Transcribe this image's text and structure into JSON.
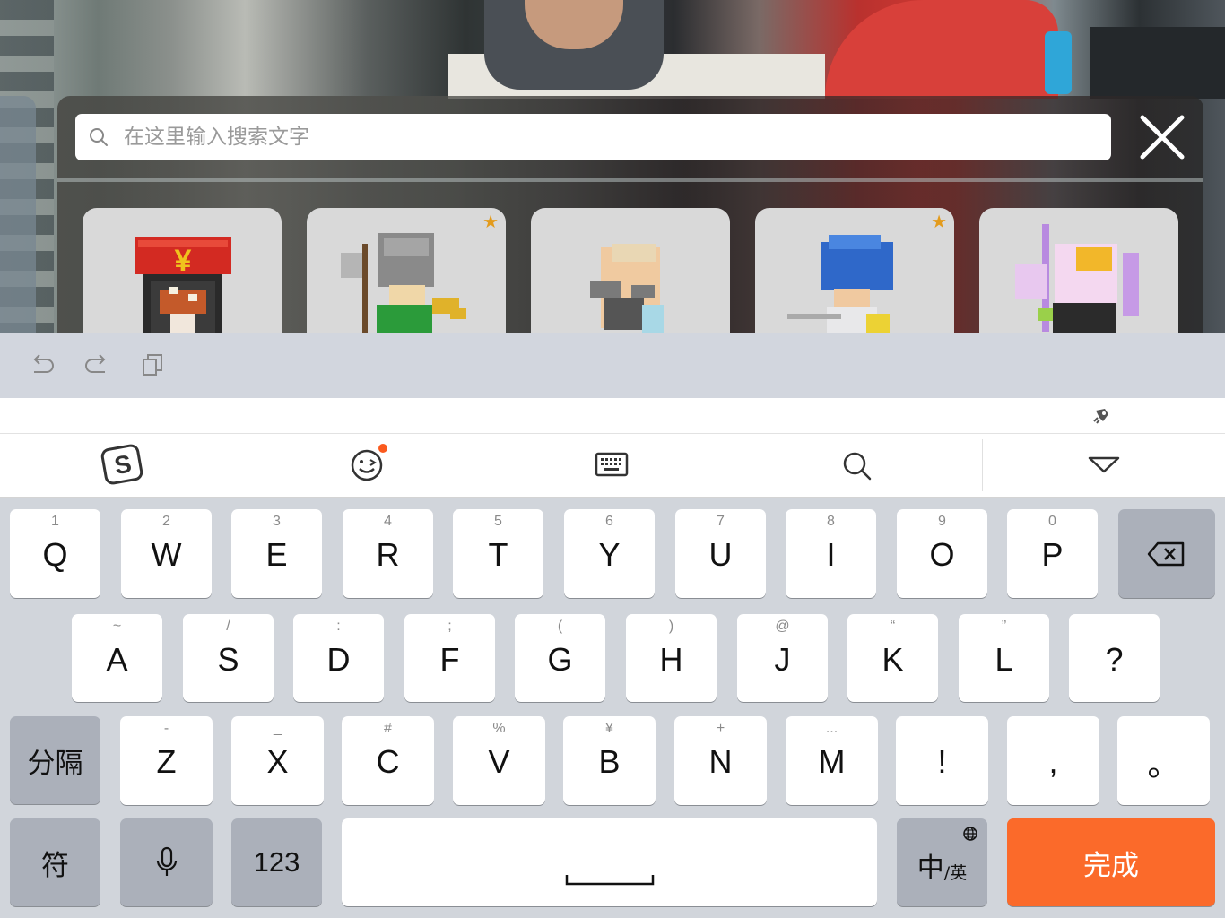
{
  "search": {
    "placeholder": "在这里输入搜索文字"
  },
  "cards": [
    {
      "name": "shop-character",
      "starred": false
    },
    {
      "name": "knight-character",
      "starred": true
    },
    {
      "name": "old-man-character",
      "starred": false
    },
    {
      "name": "blue-hair-character",
      "starred": true
    },
    {
      "name": "pink-hair-character",
      "starred": false
    }
  ],
  "colors": {
    "accent": "#fb6a2a",
    "star": "#e39b1c",
    "key_dark": "#abb0ba"
  },
  "keyboard": {
    "row1": [
      {
        "sub": "1",
        "main": "Q"
      },
      {
        "sub": "2",
        "main": "W"
      },
      {
        "sub": "3",
        "main": "E"
      },
      {
        "sub": "4",
        "main": "R"
      },
      {
        "sub": "5",
        "main": "T"
      },
      {
        "sub": "6",
        "main": "Y"
      },
      {
        "sub": "7",
        "main": "U"
      },
      {
        "sub": "8",
        "main": "I"
      },
      {
        "sub": "9",
        "main": "O"
      },
      {
        "sub": "0",
        "main": "P"
      }
    ],
    "row2": [
      {
        "sub": "~",
        "main": "A"
      },
      {
        "sub": "/",
        "main": "S"
      },
      {
        "sub": ":",
        "main": "D"
      },
      {
        "sub": ";",
        "main": "F"
      },
      {
        "sub": "(",
        "main": "G"
      },
      {
        "sub": ")",
        "main": "H"
      },
      {
        "sub": "@",
        "main": "J"
      },
      {
        "sub": "“",
        "main": "K"
      },
      {
        "sub": "”",
        "main": "L"
      },
      {
        "sub": "",
        "main": "?"
      }
    ],
    "row3": [
      {
        "sub": "-",
        "main": "Z"
      },
      {
        "sub": "_",
        "main": "X"
      },
      {
        "sub": "#",
        "main": "C"
      },
      {
        "sub": "%",
        "main": "V"
      },
      {
        "sub": "¥",
        "main": "B"
      },
      {
        "sub": "+",
        "main": "N"
      },
      {
        "sub": "...",
        "main": "M"
      },
      {
        "sub": "",
        "main": "!"
      },
      {
        "sub": "",
        "main": ","
      },
      {
        "sub": "",
        "main": "。"
      }
    ],
    "separator_label": "分隔",
    "symbol_label": "符",
    "numeric_label": "123",
    "lang_label_main": "中",
    "lang_label_sub": "/英",
    "done_label": "完成"
  }
}
